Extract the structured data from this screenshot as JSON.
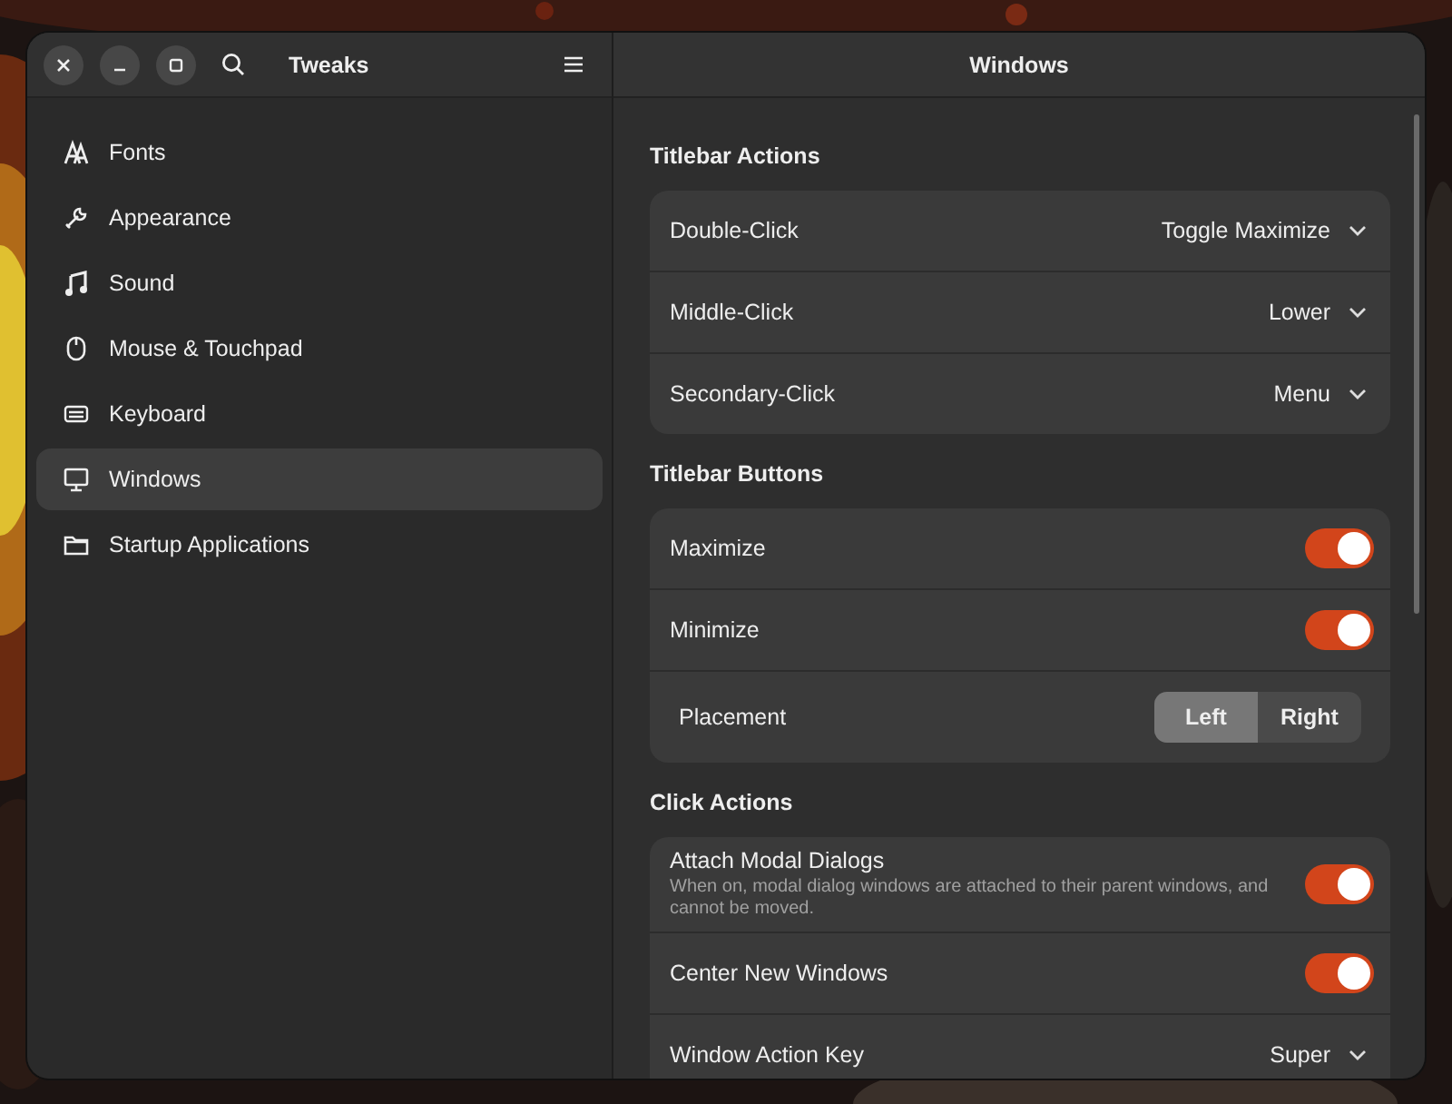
{
  "window": {
    "title": "Tweaks",
    "pane_title": "Windows"
  },
  "sidebar": {
    "items": [
      {
        "label": "Fonts",
        "selected": false
      },
      {
        "label": "Appearance",
        "selected": false
      },
      {
        "label": "Sound",
        "selected": false
      },
      {
        "label": "Mouse & Touchpad",
        "selected": false
      },
      {
        "label": "Keyboard",
        "selected": false
      },
      {
        "label": "Windows",
        "selected": true
      },
      {
        "label": "Startup Applications",
        "selected": false
      }
    ]
  },
  "sections": [
    {
      "title": "Titlebar Actions",
      "rows": [
        {
          "kind": "dropdown",
          "label": "Double-Click",
          "value": "Toggle Maximize"
        },
        {
          "kind": "dropdown",
          "label": "Middle-Click",
          "value": "Lower"
        },
        {
          "kind": "dropdown",
          "label": "Secondary-Click",
          "value": "Menu"
        }
      ]
    },
    {
      "title": "Titlebar Buttons",
      "rows": [
        {
          "kind": "switch",
          "label": "Maximize",
          "on": true
        },
        {
          "kind": "switch",
          "label": "Minimize",
          "on": true
        },
        {
          "kind": "segmented",
          "label": "Placement",
          "options": [
            {
              "label": "Left",
              "selected": true
            },
            {
              "label": "Right",
              "selected": false
            }
          ]
        }
      ]
    },
    {
      "title": "Click Actions",
      "rows": [
        {
          "kind": "switch",
          "label": "Attach Modal Dialogs",
          "description": "When on, modal dialog windows are attached to their parent windows, and cannot be moved.",
          "on": true
        },
        {
          "kind": "switch",
          "label": "Center New Windows",
          "on": true
        },
        {
          "kind": "dropdown",
          "label": "Window Action Key",
          "value": "Super"
        }
      ]
    }
  ]
}
